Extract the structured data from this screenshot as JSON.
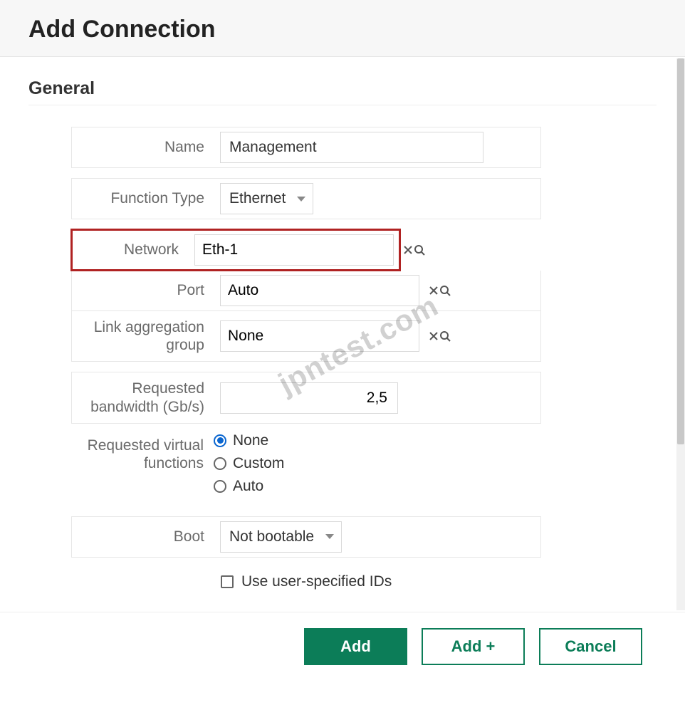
{
  "dialog": {
    "title": "Add Connection"
  },
  "section": {
    "title": "General"
  },
  "labels": {
    "name": "Name",
    "function_type": "Function Type",
    "network": "Network",
    "port": "Port",
    "lag": "Link aggregation group",
    "req_bw": "Requested bandwidth (Gb/s)",
    "req_vf": "Requested virtual functions",
    "boot": "Boot",
    "use_ids": "Use user-specified IDs"
  },
  "fields": {
    "name": "Management",
    "function_type": "Ethernet",
    "network": "Eth-1",
    "port": "Auto",
    "lag": "None",
    "req_bw": "2,5",
    "boot": "Not bootable",
    "use_ids_checked": false
  },
  "virtual_functions": {
    "options": {
      "none": "None",
      "custom": "Custom",
      "auto": "Auto"
    },
    "selected": "none"
  },
  "buttons": {
    "add": "Add",
    "add_plus": "Add +",
    "cancel": "Cancel"
  },
  "watermark": "jpntest.com"
}
